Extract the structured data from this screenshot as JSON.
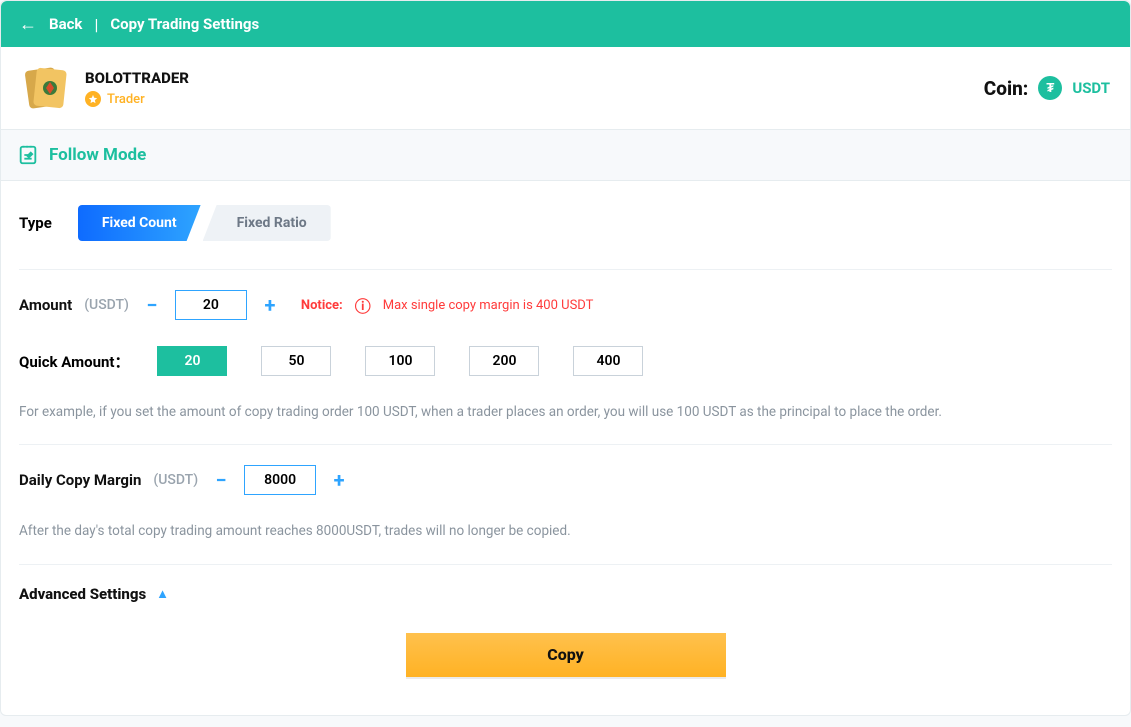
{
  "topbar": {
    "back": "Back",
    "title": "Copy Trading Settings"
  },
  "trader": {
    "name": "BOLOTTRADER",
    "role": "Trader"
  },
  "coin": {
    "label": "Coin:",
    "symbol": "USDT",
    "iconGlyph": "₮",
    "color": "#1dbf9f"
  },
  "followMode": {
    "title": "Follow Mode"
  },
  "type": {
    "label": "Type",
    "tabs": [
      {
        "label": "Fixed Count",
        "active": true
      },
      {
        "label": "Fixed Ratio",
        "active": false
      }
    ]
  },
  "amount": {
    "label": "Amount",
    "unit": "(USDT)",
    "value": "20",
    "noticeLabel": "Notice:",
    "noticeText": "Max single copy margin is 400 USDT"
  },
  "quick": {
    "label": "Quick Amount：",
    "options": [
      "20",
      "50",
      "100",
      "200",
      "400"
    ],
    "selected": "20",
    "helper": "For example, if you set the amount of copy trading order 100 USDT, when a trader places an order, you will use 100 USDT as the principal to place the order."
  },
  "daily": {
    "label": "Daily Copy Margin",
    "unit": "(USDT)",
    "value": "8000",
    "helper": "After the day's total copy trading amount reaches 8000USDT, trades will no longer be copied."
  },
  "advanced": {
    "label": "Advanced Settings"
  },
  "actions": {
    "copy": "Copy"
  }
}
